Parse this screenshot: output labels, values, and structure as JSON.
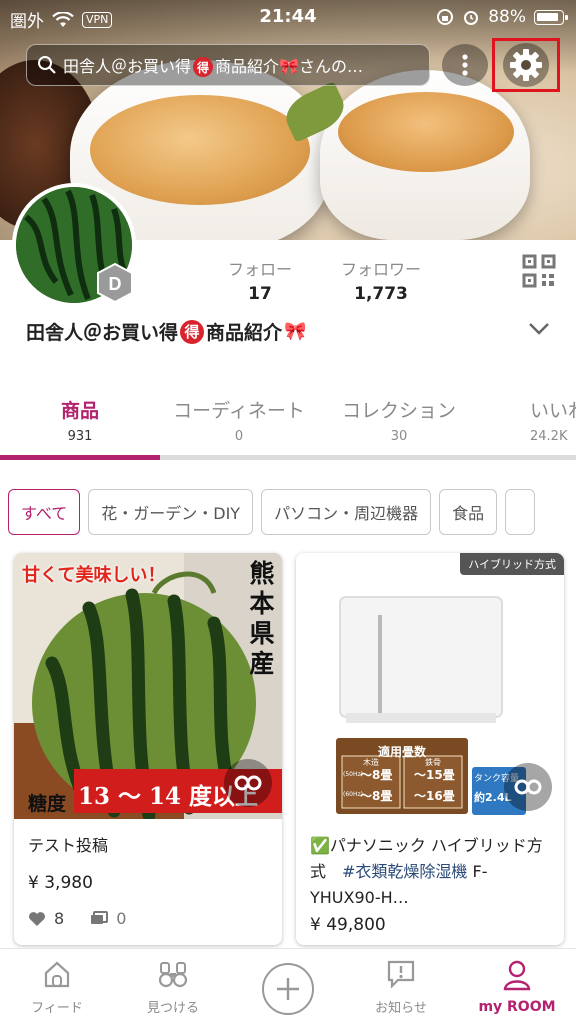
{
  "status_bar": {
    "carrier": "圏外",
    "vpn": "VPN",
    "time": "21:44",
    "battery": "88%"
  },
  "header": {
    "search_text": "田舎人＠お買い得",
    "search_text_suffix": "商品紹介",
    "search_text_tail": "さんの…"
  },
  "profile": {
    "badge_letter": "D",
    "follow_label": "フォロー",
    "follow_count": "17",
    "follower_label": "フォロワー",
    "follower_count": "1,773",
    "name_prefix": "田舎人＠お買い得",
    "name_suffix": "商品紹介",
    "toku_glyph": "得"
  },
  "tabs": [
    {
      "label": "商品",
      "count": "931"
    },
    {
      "label": "コーディネート",
      "count": "0"
    },
    {
      "label": "コレクション",
      "count": "30"
    },
    {
      "label": "いいね",
      "count": "24.2K"
    }
  ],
  "filters": [
    "すべて",
    "花・ガーデン・DIY",
    "パソコン・周辺機器",
    "食品"
  ],
  "products": [
    {
      "overlay_top": "甘くて美味しい！",
      "overlay_side": [
        "熊",
        "本",
        "県",
        "産"
      ],
      "overlay_bottom_left": "糖度",
      "overlay_bottom": "13 ～ 14 度以上",
      "title": "テスト投稿",
      "price": "¥ 3,980",
      "likes": "8",
      "comments": "0"
    },
    {
      "tag": "ハイブリッド方式",
      "chart_title": "適用畳数",
      "chart_col1_head": "木造",
      "chart_col2_head": "鉄骨",
      "chart_50_hz": "(50Hz)",
      "chart_60_hz": "(60Hz)",
      "chart_col1_50": "～8畳",
      "chart_col1_60": "～8畳",
      "chart_col2_50": "～15畳",
      "chart_col2_60": "～16畳",
      "tank_label": "タンク容量",
      "tank_value": "約2.4L",
      "check": "✅",
      "title_line": "パナソニック ハイブリッド方式　",
      "hashtag": "#衣類乾燥除湿機",
      "title_tail": " F-YHUX90-H…",
      "price": "¥ 49,800"
    }
  ],
  "bottom_nav": [
    {
      "label": "フィード"
    },
    {
      "label": "見つける"
    },
    {
      "label": ""
    },
    {
      "label": "お知らせ"
    },
    {
      "label": "my ROOM"
    }
  ],
  "colors": {
    "accent": "#b3226e",
    "highlight_box": "#e0141e",
    "toku_red": "#d8242d"
  }
}
